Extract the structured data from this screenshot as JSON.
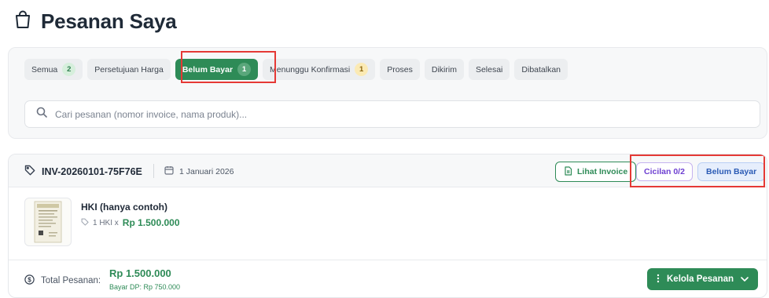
{
  "page": {
    "title": "Pesanan Saya"
  },
  "tabs": [
    {
      "label": "Semua",
      "count": "2",
      "count_color": "green",
      "active": false
    },
    {
      "label": "Persetujuan Harga",
      "count": null,
      "active": false
    },
    {
      "label": "Belum Bayar",
      "count": "1",
      "count_color": "green",
      "active": true
    },
    {
      "label": "Menunggu Konfirmasi",
      "count": "1",
      "count_color": "yellow",
      "active": false
    },
    {
      "label": "Proses",
      "count": null,
      "active": false
    },
    {
      "label": "Dikirim",
      "count": null,
      "active": false
    },
    {
      "label": "Selesai",
      "count": null,
      "active": false
    },
    {
      "label": "Dibatalkan",
      "count": null,
      "active": false
    }
  ],
  "search": {
    "placeholder": "Cari pesanan (nomor invoice, nama produk)...",
    "value": ""
  },
  "order": {
    "invoice_number": "INV-20260101-75F76E",
    "date": "1 Januari 2026",
    "view_invoice_label": "Lihat Invoice",
    "installment_badge": "Cicilan 0/2",
    "status_badge": "Belum Bayar",
    "product": {
      "name": "HKI (hanya contoh)",
      "quantity_text": "1 HKI x",
      "price": "Rp 1.500.000"
    },
    "total_label": "Total Pesanan:",
    "total_value": "Rp 1.500.000",
    "dp_text": "Bayar DP: Rp 750.000",
    "manage_label": "Kelola Pesanan"
  },
  "colors": {
    "accent": "#2e8b57",
    "highlight": "#e53935",
    "status_blue": "#2b5bb5",
    "installment_purple": "#6d3fd1"
  }
}
